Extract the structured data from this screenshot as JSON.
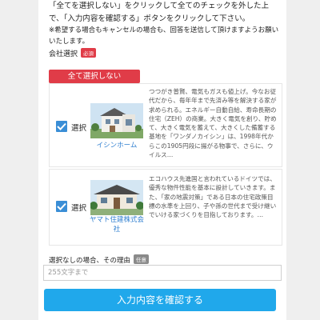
{
  "intro_text": "「全てを選択しない」をクリックして全てのチェックを外した上で、「入力内容を確認する」ボタンをクリックして下さい。",
  "note_text": "※希望する場合もキャンセルの場合も、回答を送信して頂けますようお願いいたします。",
  "company_select": {
    "label": "会社選択",
    "required_badge": "必須"
  },
  "deselect_all_label": "全て選択しない",
  "companies": [
    {
      "checkbox_label": "選択",
      "checked": true,
      "name": "イシンホーム",
      "description": "つつがき普賢、電気もガスも値上げ。今なお従代だから、毎年年まで先済み等を解決する家が求められる。エネルギー自動自給、寿命長期の住宅（ZEH）の商業。大きく電気を創り、貯めて、大きく電気を蓄えて、大きくした備蓄する基地を「ワンダノカイシン」は、1998年代からこの1905円段に揚がる物事で、さらに、ウイルス…"
    },
    {
      "checkbox_label": "選択",
      "checked": true,
      "name": "ヤマト住建株式会社",
      "description": "エコハウス先進国と言われているドイツでは、優秀な物件性能を基本に設計していきます。また、「家の地震対策」である日本の住宅政策目標の水準を上回り、子や孫の世代まで受け継いでいける家づくりを目指しております。…"
    }
  ],
  "reason_field": {
    "label": "選択なしの場合、その理由",
    "optional_badge": "任意",
    "placeholder": "255文字まで"
  },
  "confirm_button_label": "入力内容を確認する",
  "colors": {
    "accent_red": "#e03c48",
    "primary_blue": "#20a8eb",
    "checkbox_blue": "#3a8ed6",
    "link_blue": "#2f7fd0"
  }
}
